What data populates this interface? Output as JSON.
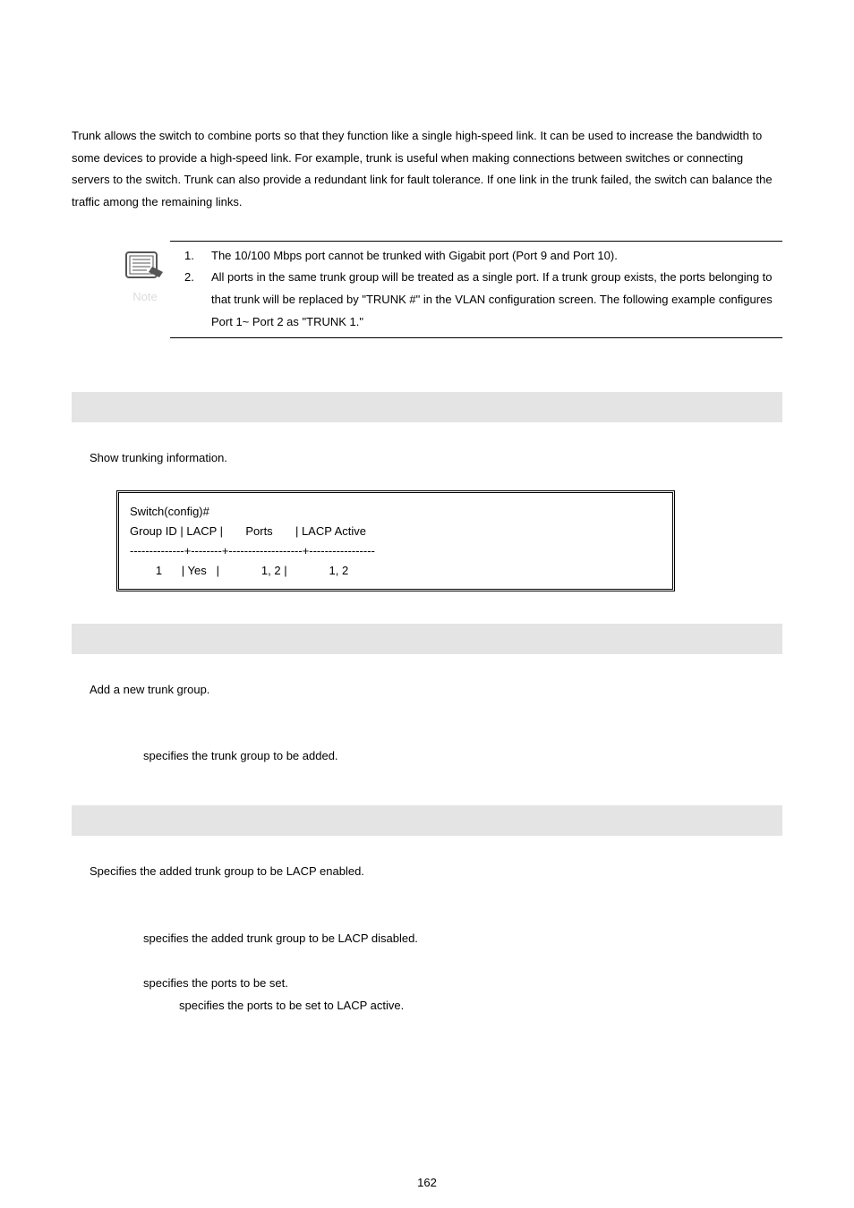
{
  "intro": "Trunk allows the switch to combine ports so that they function like a single high-speed link. It can be used to increase the bandwidth to some devices to provide a high-speed link. For example, trunk is useful when making connections between switches or connecting servers to the switch. Trunk can also provide a redundant link for fault tolerance. If one link in the trunk failed, the switch can balance the traffic among the remaining links.",
  "note": {
    "label": "Note",
    "items": [
      {
        "num": "1.",
        "text": "The 10/100 Mbps port cannot be trunked with Gigabit port (Port 9 and Port 10)."
      },
      {
        "num": "2.",
        "text": "All ports in the same trunk group will be treated as a single port. If a trunk group exists, the ports belonging to that trunk will be replaced by \"TRUNK #\" in the VLAN configuration screen. The following example configures Port 1~ Port 2 as \"TRUNK 1.\""
      }
    ]
  },
  "section1": {
    "desc": "Show trunking information.",
    "terminal": "Switch(config)#\nGroup ID | LACP |       Ports       | LACP Active\n--------------+--------+-------------------+-----------------\n        1      | Yes   |             1, 2 |             1, 2"
  },
  "section2": {
    "desc": "Add a new trunk group.",
    "line1": "specifies the trunk group to be added."
  },
  "section3": {
    "desc": "Specifies the added trunk group to be LACP enabled.",
    "line1": "specifies the added trunk group to be LACP disabled.",
    "line2": "specifies the ports to be set.",
    "line3": "specifies the ports to be set to LACP active."
  },
  "pageNumber": "162"
}
